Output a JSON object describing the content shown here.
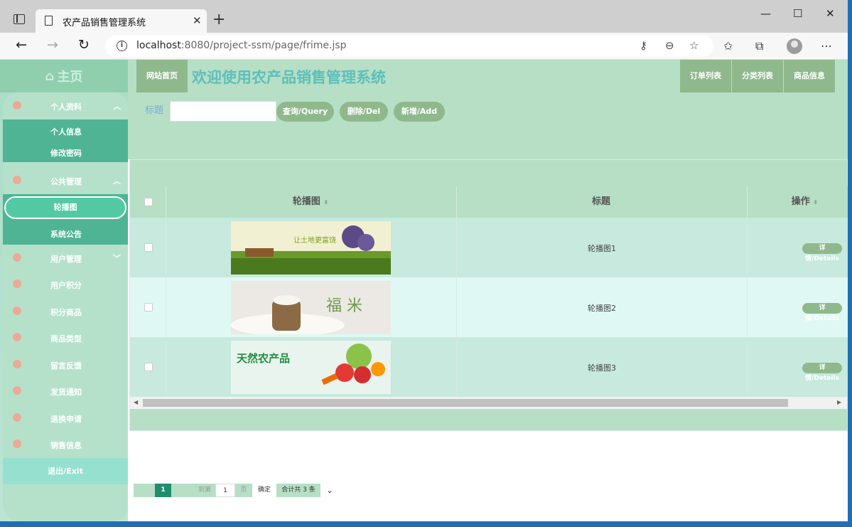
{
  "browser": {
    "tab_title": "农产品销售管理系统",
    "url_host": "localhost",
    "url_rest": ":8080/project-ssm/page/frime.jsp",
    "window_buttons": [
      "—",
      "☐",
      "✕"
    ]
  },
  "sidebar": {
    "home": "主页",
    "groups": [
      {
        "label": "个人资料",
        "children": [
          "个人信息",
          "修改密码"
        ]
      },
      {
        "label": "公共管理",
        "children": [
          "轮播图",
          "系统公告"
        ]
      },
      {
        "label": "用户管理"
      },
      {
        "label": "用户积分"
      },
      {
        "label": "积分商品"
      },
      {
        "label": "商品类型"
      },
      {
        "label": "留言反馈"
      },
      {
        "label": "发货通知"
      },
      {
        "label": "退换申请"
      },
      {
        "label": "销售信息"
      }
    ],
    "logout": "退出/Exit"
  },
  "topbar": {
    "home": "网站首页",
    "welcome": "欢迎使用农产品销售管理系统",
    "links": [
      "订单列表",
      "分类列表",
      "商品信息"
    ]
  },
  "search": {
    "label": "标题",
    "value": "",
    "buttons": {
      "query": "查询/Query",
      "delete": "删除/Del",
      "add": "新增/Add"
    }
  },
  "table": {
    "headers": [
      "轮播图",
      "标题",
      "操作"
    ],
    "rows": [
      {
        "title": "轮播图1",
        "action": "详情/Details",
        "banner": "让土地更富饶"
      },
      {
        "title": "轮播图2",
        "action": "详情/Details",
        "banner": "福 米"
      },
      {
        "title": "轮播图3",
        "action": "详情/Details",
        "banner": "天然农产品"
      }
    ]
  },
  "pager": {
    "current": "1",
    "goto_label": "到第",
    "goto_value": "1",
    "page_unit": "页",
    "confirm": "确定",
    "total": "合计共 3 条"
  },
  "colors": {
    "accent": "#8fb98c",
    "header_bg": "#b6dfc5",
    "sidebar_sub": "#4fb494",
    "title": "#5ebfbb"
  }
}
